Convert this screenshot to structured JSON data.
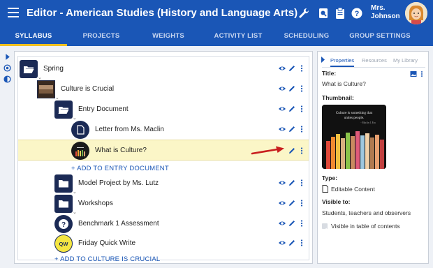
{
  "header": {
    "title": "Editor - American Studies (History and Language Arts)",
    "user_name_line1": "Mrs.",
    "user_name_line2": "Johnson",
    "background": "#1a56b6"
  },
  "tabs": [
    {
      "label": "SYLLABUS",
      "active": true
    },
    {
      "label": "PROJECTS",
      "active": false
    },
    {
      "label": "WEIGHTS",
      "active": false
    },
    {
      "label": "ACTIVITY LIST",
      "active": false
    },
    {
      "label": "SCHEDULING",
      "active": false
    },
    {
      "label": "GROUP SETTINGS",
      "active": false
    }
  ],
  "tree": {
    "rows": [
      {
        "label": "Spring",
        "icon": "folder-open-icon"
      },
      {
        "label": "Culture is Crucial",
        "icon": "thumbnail-image"
      },
      {
        "label": "Entry Document",
        "icon": "folder-open-icon"
      },
      {
        "label": "Letter from Ms. Maclin",
        "icon": "document-icon"
      },
      {
        "label": "What is Culture?",
        "icon": "image-thumbnail-icon",
        "selected": true
      },
      {
        "label": "Model Project by Ms. Lutz",
        "icon": "folder-icon"
      },
      {
        "label": "Workshops",
        "icon": "folder-icon"
      },
      {
        "label": "Benchmark 1 Assessment",
        "icon": "question-icon"
      },
      {
        "label": "Friday Quick Write",
        "icon": "qw-icon"
      }
    ],
    "add_entry_document": "ADD TO ENTRY DOCUMENT",
    "add_culture": "ADD TO CULTURE IS CRUCIAL",
    "highlight_color": "#fbf6c7",
    "arrow_color": "#c81e1e"
  },
  "properties": {
    "tabs": [
      "Properties",
      "Resources",
      "My Library"
    ],
    "title_label": "Title:",
    "title_value": "What is Culture?",
    "thumbnail_label": "Thumbnail:",
    "thumbnail_text": "Culture is something that unites people.",
    "thumbnail_author": "- Maclin I. Era",
    "type_label": "Type:",
    "type_value": "Editable Content",
    "visible_label": "Visible to:",
    "visible_value": "Students, teachers and observers",
    "visible_in_table": "Visible in table of contents",
    "visible_in_table_checked": true
  }
}
